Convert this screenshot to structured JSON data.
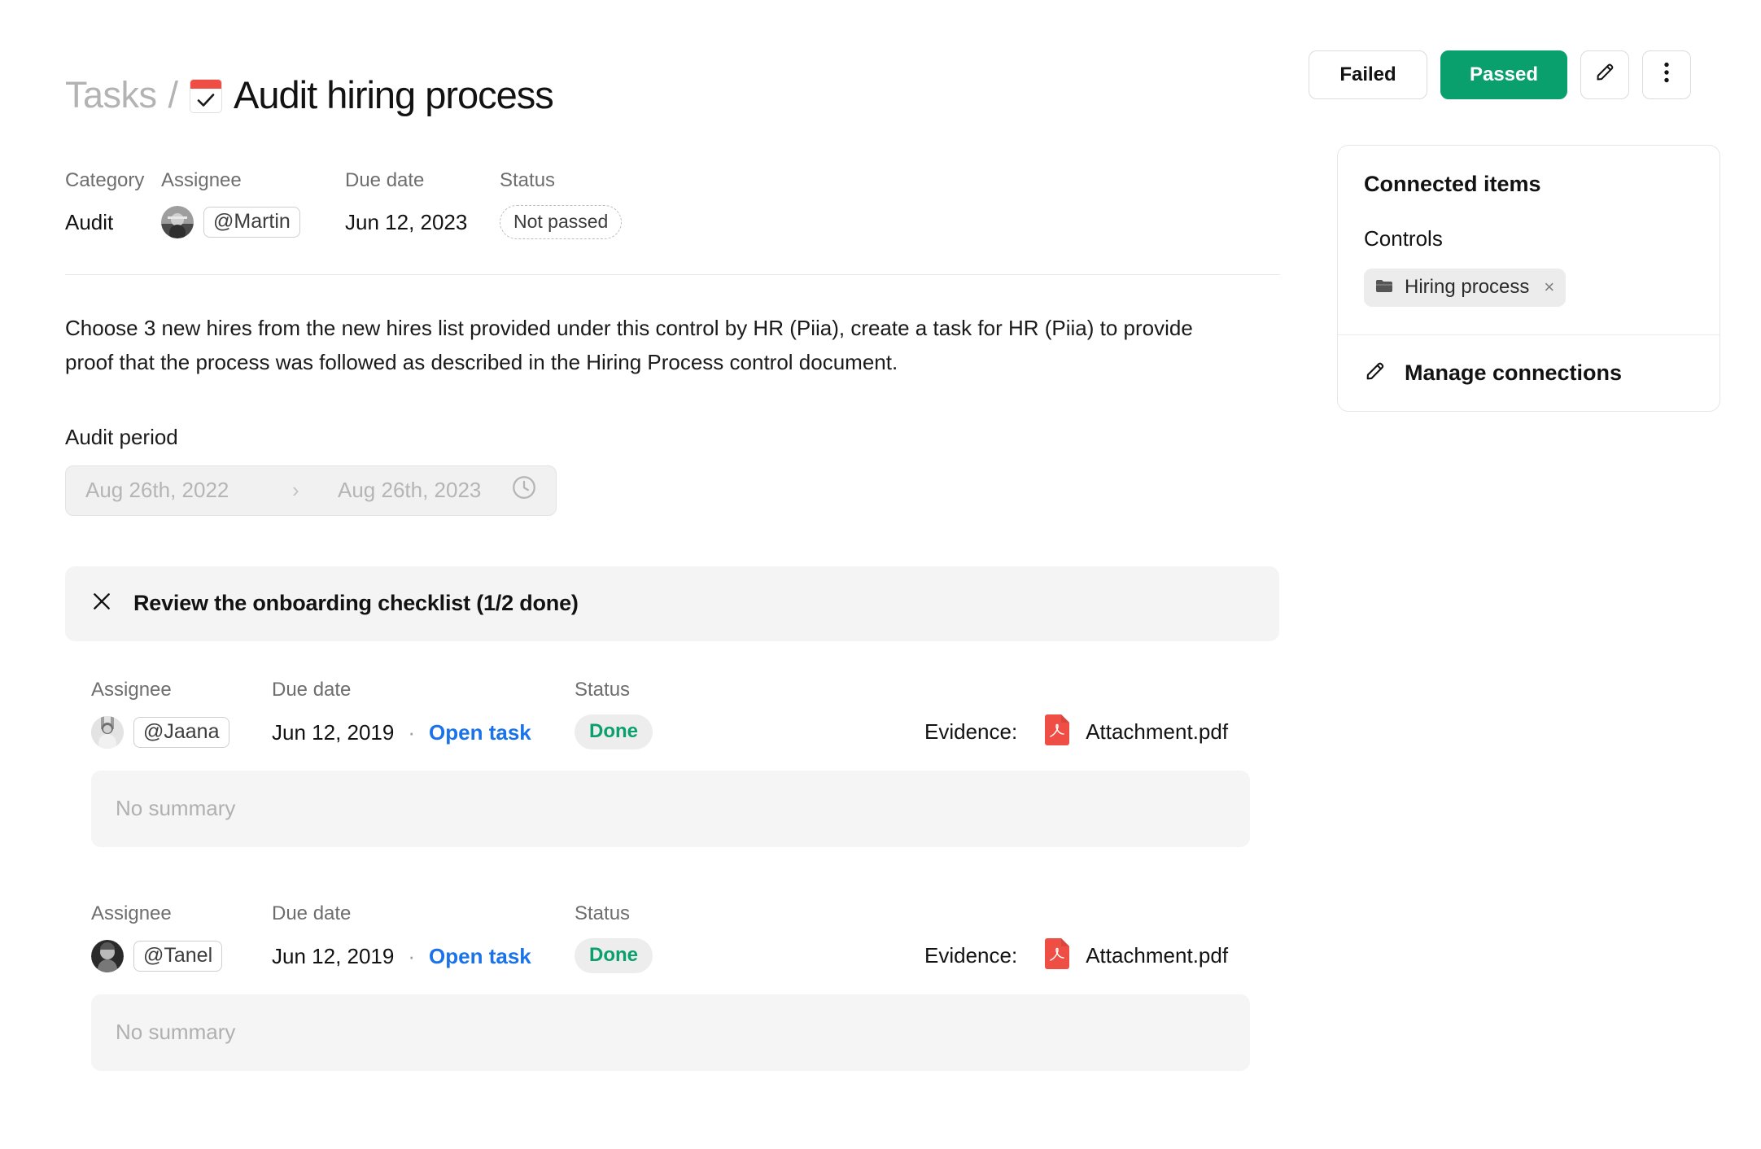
{
  "header": {
    "breadcrumb_parent": "Tasks",
    "breadcrumb_separator": "/",
    "task_icon": "task-card-icon",
    "title": "Audit hiring process",
    "actions": {
      "failed_label": "Failed",
      "passed_label": "Passed",
      "edit_icon": "pencil-icon",
      "more_icon": "more-vertical-icon"
    }
  },
  "meta": {
    "category_label": "Category",
    "category_value": "Audit",
    "assignee_label": "Assignee",
    "assignee_value": "@Martin",
    "due_date_label": "Due date",
    "due_date_value": "Jun 12, 2023",
    "status_label": "Status",
    "status_value": "Not passed"
  },
  "description": "Choose 3 new hires from the new hires list provided under this control by HR (Piia), create a task for HR (Piia) to provide proof that the process was followed as described in the Hiring Process control document.",
  "audit_period": {
    "label": "Audit period",
    "start": "Aug 26th, 2022",
    "separator": "›",
    "end": "Aug 26th, 2023",
    "icon": "clock-icon"
  },
  "checklist": {
    "collapse_icon": "close-x-icon",
    "title": "Review the onboarding checklist (1/2 done)"
  },
  "subtasks": [
    {
      "assignee_label": "Assignee",
      "assignee_value": "@Jaana",
      "due_date_label": "Due date",
      "due_date_value": "Jun 12, 2019",
      "separator": "·",
      "open_task_label": "Open task",
      "status_label": "Status",
      "status_value": "Done",
      "evidence_label": "Evidence:",
      "attachment_icon": "pdf-file-icon",
      "attachment_name": "Attachment.pdf",
      "summary_placeholder": "No summary"
    },
    {
      "assignee_label": "Assignee",
      "assignee_value": "@Tanel",
      "due_date_label": "Due date",
      "due_date_value": "Jun 12, 2019",
      "separator": "·",
      "open_task_label": "Open task",
      "status_label": "Status",
      "status_value": "Done",
      "evidence_label": "Evidence:",
      "attachment_icon": "pdf-file-icon",
      "attachment_name": "Attachment.pdf",
      "summary_placeholder": "No summary"
    }
  ],
  "connected_items": {
    "title": "Connected items",
    "group_label": "Controls",
    "chip_icon": "folder-icon",
    "chip_label": "Hiring process",
    "chip_remove": "×",
    "manage_icon": "pencil-icon",
    "manage_label": "Manage connections"
  },
  "colors": {
    "accent_green": "#0aa06e",
    "link_blue": "#1a73e8",
    "pdf_red": "#ef4e45",
    "task_icon_red": "#ef4e45",
    "muted_text": "#6e6e6e",
    "placeholder_text": "#b0b0b0"
  }
}
